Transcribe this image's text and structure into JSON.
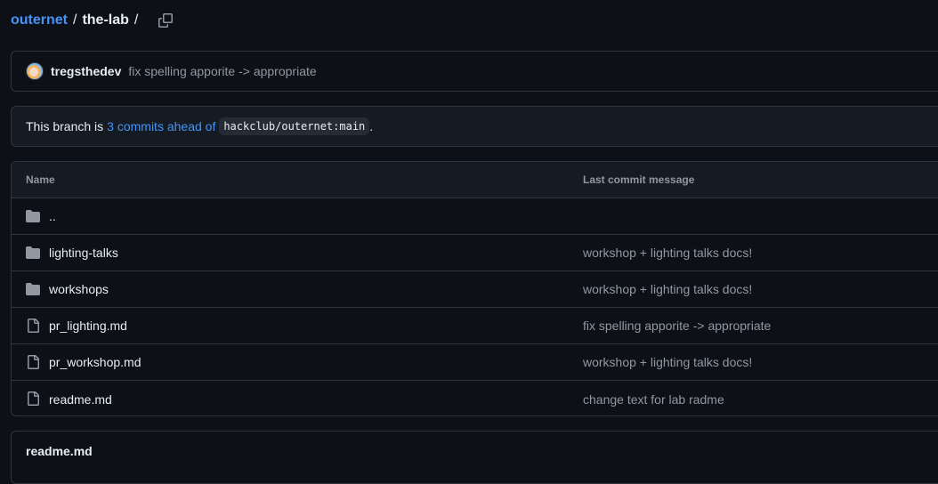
{
  "breadcrumb": {
    "repo": "outernet",
    "sep1": "/",
    "folder": "the-lab",
    "sep2": "/",
    "copy_icon": "copy-icon"
  },
  "latest_commit": {
    "author": "tregsthedev",
    "message": "fix spelling apporite -> appropriate"
  },
  "branch_status": {
    "prefix": "This branch is",
    "link": "3 commits ahead of",
    "ref": "hackclub/outernet:main",
    "suffix": "."
  },
  "files": {
    "columns": [
      "Name",
      "Last commit message"
    ],
    "rows": [
      {
        "type": "parent",
        "name": "..",
        "commit": ""
      },
      {
        "type": "folder",
        "name": "lighting-talks",
        "commit": "workshop + lighting talks docs!"
      },
      {
        "type": "folder",
        "name": "workshops",
        "commit": "workshop + lighting talks docs!"
      },
      {
        "type": "file",
        "name": "pr_lighting.md",
        "commit": "fix spelling apporite -> appropriate"
      },
      {
        "type": "file",
        "name": "pr_workshop.md",
        "commit": "workshop + lighting talks docs!"
      },
      {
        "type": "file",
        "name": "readme.md",
        "commit": "change text for lab radme"
      }
    ]
  },
  "readme": {
    "title": "readme.md"
  },
  "colors": {
    "background": "#0d1117",
    "link": "#4493f8",
    "muted": "#9198a1",
    "border": "#30363d"
  }
}
